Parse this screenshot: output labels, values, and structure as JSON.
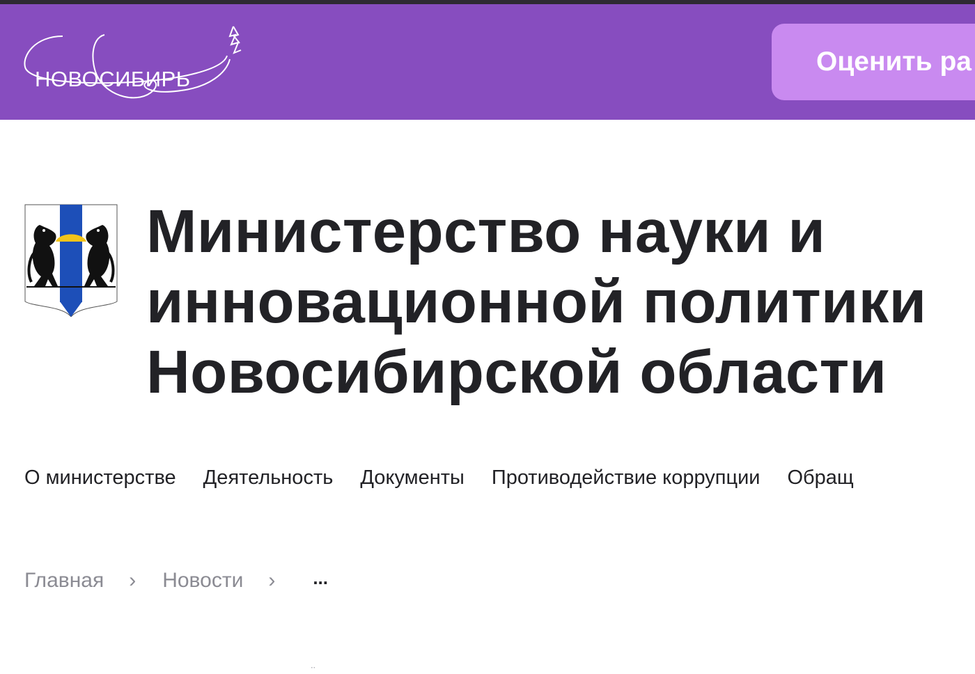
{
  "header": {
    "logo_text": "НОВОСИБИРЬ",
    "rate_button_label": "Оценить ра",
    "background_color": "#874dbf",
    "button_color": "#c98af0"
  },
  "org": {
    "title_lines": [
      "Министерство науки и",
      "инновационной политики",
      "Новосибирской области"
    ],
    "emblem_icon": "novosibirsk-coat-of-arms-icon"
  },
  "nav": {
    "items": [
      {
        "label": "О министерстве"
      },
      {
        "label": "Деятельность"
      },
      {
        "label": "Документы"
      },
      {
        "label": "Противодействие коррупции"
      },
      {
        "label": "Обращ"
      }
    ]
  },
  "breadcrumb": {
    "items": [
      {
        "label": "Главная"
      },
      {
        "label": "Новости"
      }
    ],
    "separator": "›",
    "current": "..."
  }
}
